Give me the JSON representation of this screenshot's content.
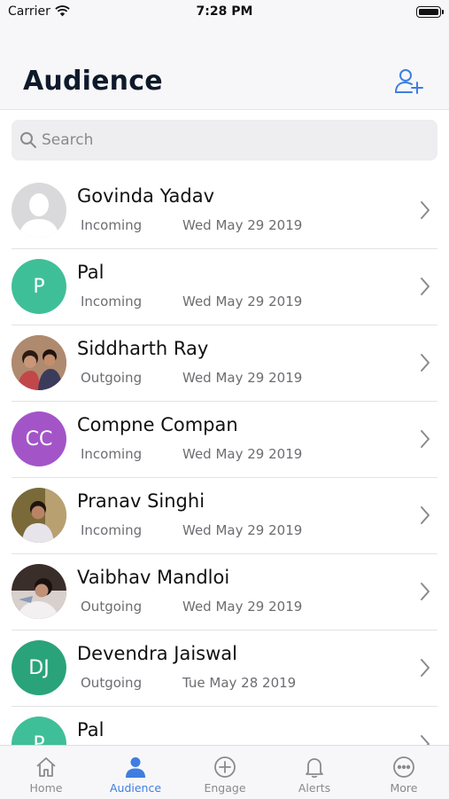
{
  "status_bar": {
    "carrier": "Carrier",
    "time": "7:28 PM"
  },
  "header": {
    "title": "Audience"
  },
  "search": {
    "placeholder": "Search"
  },
  "colors": {
    "accent": "#3f7de0",
    "green": "#3fbf98",
    "purple": "#a355c8",
    "dark_green": "#2aa37a"
  },
  "contacts": [
    {
      "name": "Govinda Yadav",
      "direction": "Incoming",
      "date": "Wed May 29 2019",
      "avatar": "placeholder"
    },
    {
      "name": "Pal",
      "direction": "Incoming",
      "date": "Wed May 29 2019",
      "initials": "P"
    },
    {
      "name": "Siddharth Ray",
      "direction": "Outgoing",
      "date": "Wed May 29 2019",
      "avatar": "photo"
    },
    {
      "name": "Compne Compan",
      "direction": "Incoming",
      "date": "Wed May 29 2019",
      "initials": "CC"
    },
    {
      "name": "Pranav Singhi",
      "direction": "Incoming",
      "date": "Wed May 29 2019",
      "avatar": "photo"
    },
    {
      "name": "Vaibhav Mandloi",
      "direction": "Outgoing",
      "date": "Wed May 29 2019",
      "avatar": "photo"
    },
    {
      "name": "Devendra Jaiswal",
      "direction": "Outgoing",
      "date": "Tue May 28 2019",
      "initials": "DJ"
    },
    {
      "name": "Pal",
      "direction": "",
      "date": "",
      "initials": "P"
    }
  ],
  "tabs": [
    {
      "label": "Home",
      "icon": "home-icon"
    },
    {
      "label": "Audience",
      "icon": "person-icon",
      "active": true
    },
    {
      "label": "Engage",
      "icon": "plus-circle-icon"
    },
    {
      "label": "Alerts",
      "icon": "bell-icon"
    },
    {
      "label": "More",
      "icon": "more-icon"
    }
  ]
}
